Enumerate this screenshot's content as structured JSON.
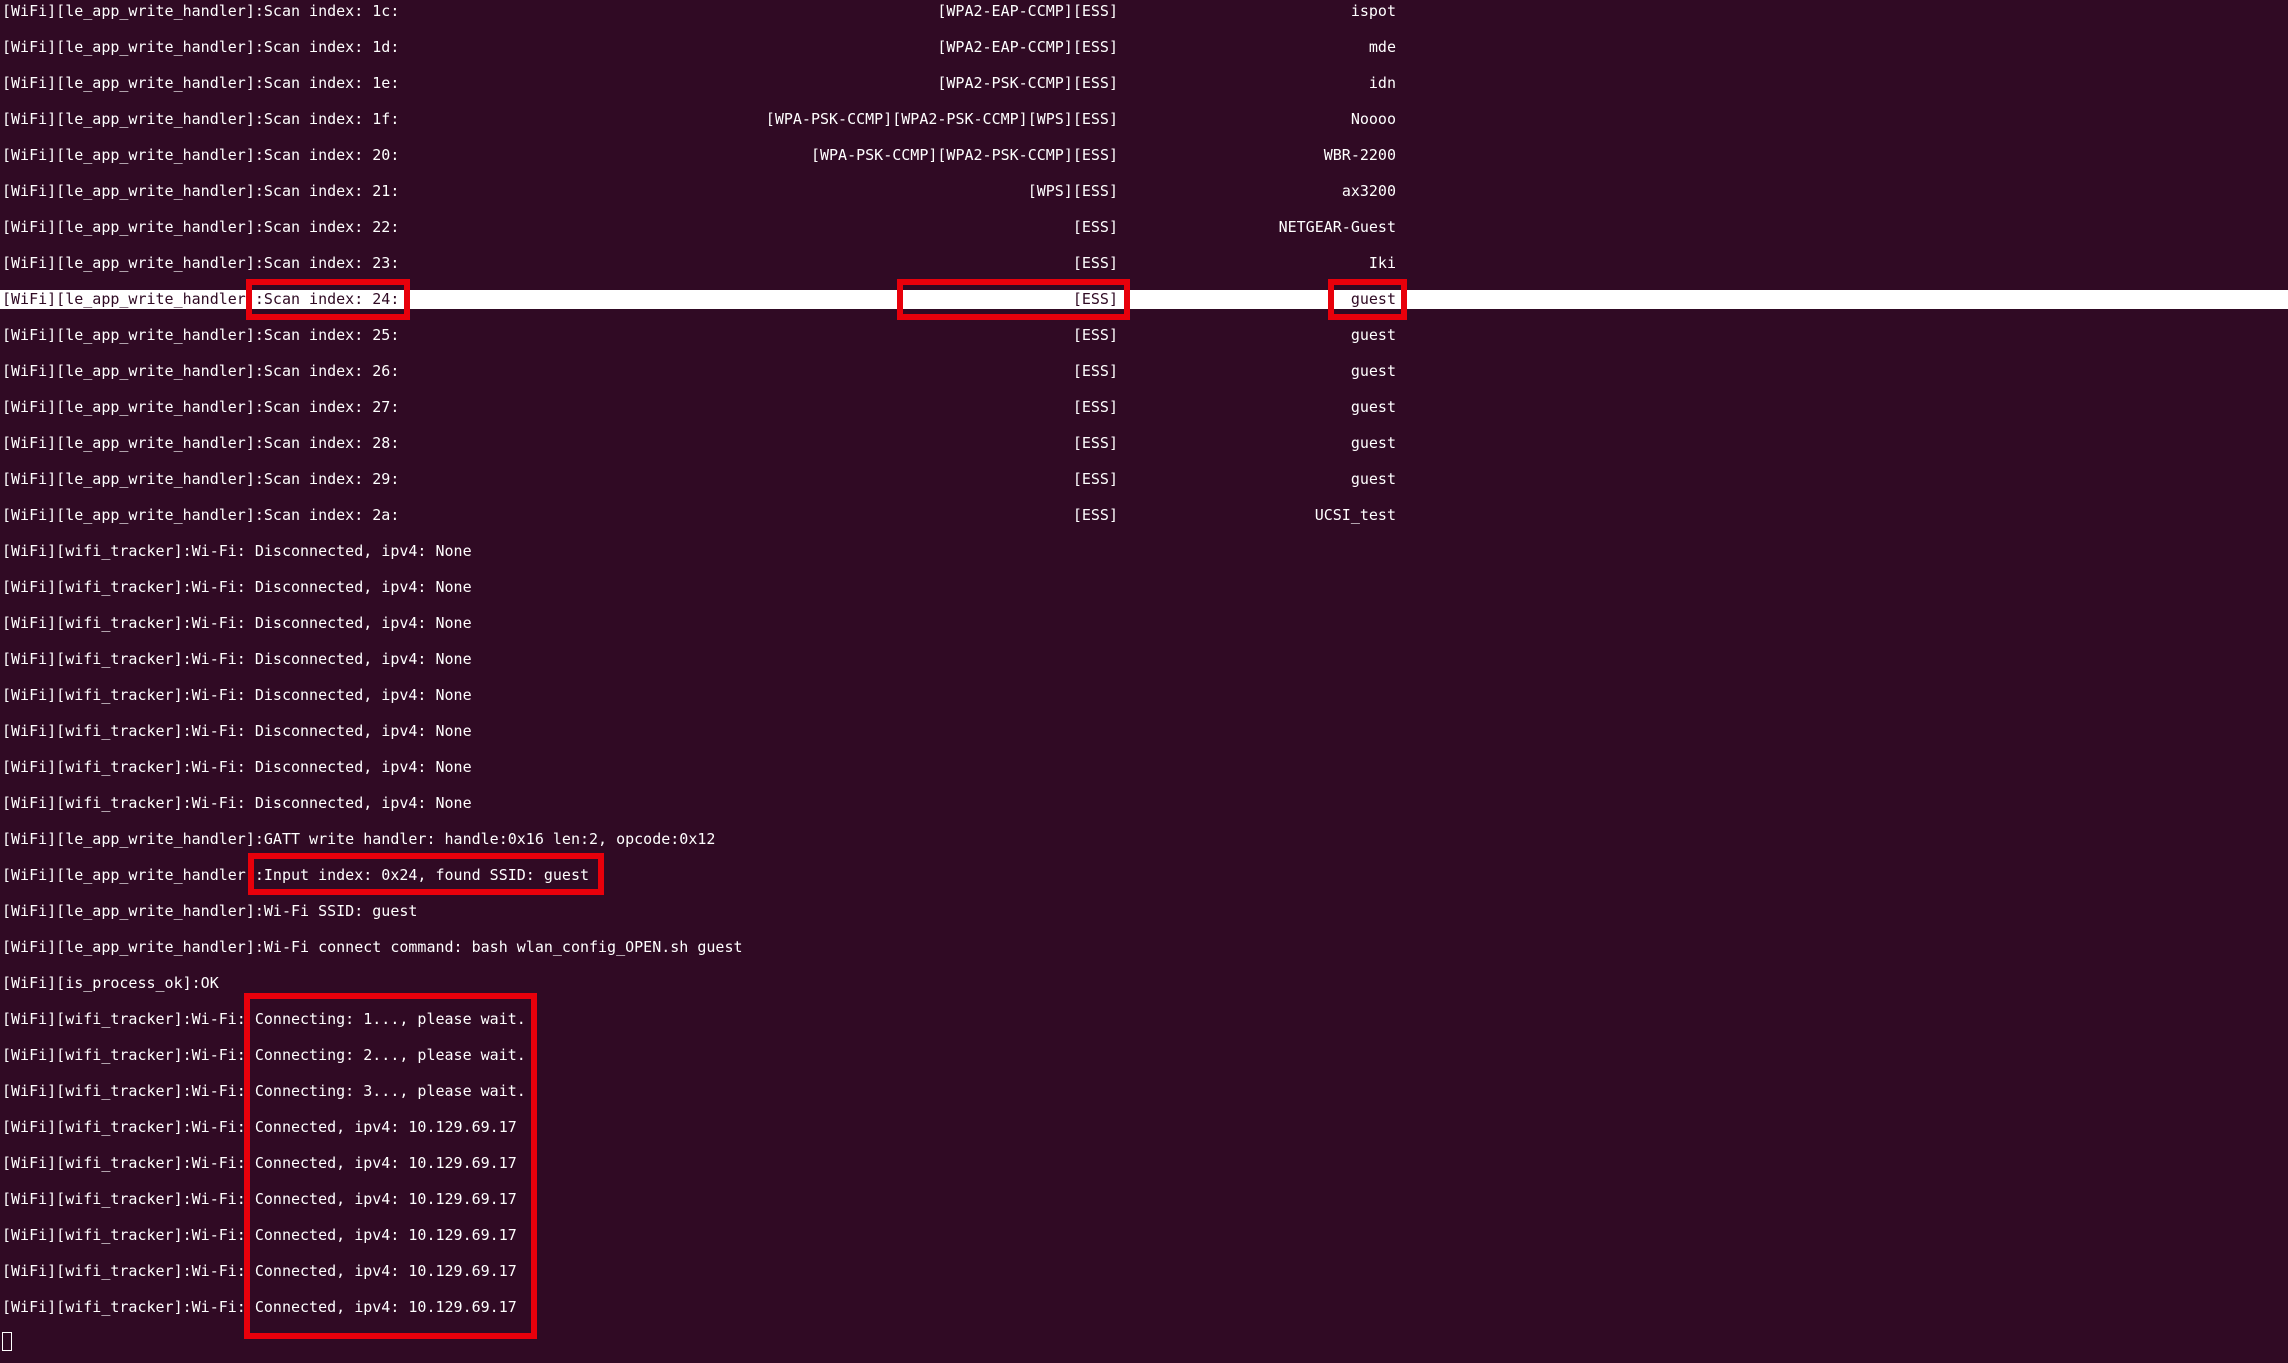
{
  "scan_rows": [
    {
      "prefix": "[WiFi][le_app_write_handler]:Scan index: 1c:",
      "flags": "[WPA2-EAP-CCMP][ESS]",
      "ssid": "ispot"
    },
    {
      "prefix": "[WiFi][le_app_write_handler]:Scan index: 1d:",
      "flags": "[WPA2-EAP-CCMP][ESS]",
      "ssid": "mde"
    },
    {
      "prefix": "[WiFi][le_app_write_handler]:Scan index: 1e:",
      "flags": "[WPA2-PSK-CCMP][ESS]",
      "ssid": "idn"
    },
    {
      "prefix": "[WiFi][le_app_write_handler]:Scan index: 1f:",
      "flags": "[WPA-PSK-CCMP][WPA2-PSK-CCMP][WPS][ESS]",
      "ssid": "Noooo"
    },
    {
      "prefix": "[WiFi][le_app_write_handler]:Scan index: 20:",
      "flags": "[WPA-PSK-CCMP][WPA2-PSK-CCMP][ESS]",
      "ssid": "WBR-2200"
    },
    {
      "prefix": "[WiFi][le_app_write_handler]:Scan index: 21:",
      "flags": "[WPS][ESS]",
      "ssid": "ax3200"
    },
    {
      "prefix": "[WiFi][le_app_write_handler]:Scan index: 22:",
      "flags": "[ESS]",
      "ssid": "NETGEAR-Guest"
    },
    {
      "prefix": "[WiFi][le_app_write_handler]:Scan index: 23:",
      "flags": "[ESS]",
      "ssid": "Iki"
    },
    {
      "prefix": "[WiFi][le_app_write_handler]:Scan index: 24:",
      "flags": "[ESS]",
      "ssid": "guest"
    },
    {
      "prefix": "[WiFi][le_app_write_handler]:Scan index: 25:",
      "flags": "[ESS]",
      "ssid": "guest"
    },
    {
      "prefix": "[WiFi][le_app_write_handler]:Scan index: 26:",
      "flags": "[ESS]",
      "ssid": "guest"
    },
    {
      "prefix": "[WiFi][le_app_write_handler]:Scan index: 27:",
      "flags": "[ESS]",
      "ssid": "guest"
    },
    {
      "prefix": "[WiFi][le_app_write_handler]:Scan index: 28:",
      "flags": "[ESS]",
      "ssid": "guest"
    },
    {
      "prefix": "[WiFi][le_app_write_handler]:Scan index: 29:",
      "flags": "[ESS]",
      "ssid": "guest"
    },
    {
      "prefix": "[WiFi][le_app_write_handler]:Scan index: 2a:",
      "flags": "[ESS]",
      "ssid": "UCSI_test"
    }
  ],
  "log_lines": [
    "[WiFi][wifi_tracker]:Wi-Fi: Disconnected, ipv4: None",
    "[WiFi][wifi_tracker]:Wi-Fi: Disconnected, ipv4: None",
    "[WiFi][wifi_tracker]:Wi-Fi: Disconnected, ipv4: None",
    "[WiFi][wifi_tracker]:Wi-Fi: Disconnected, ipv4: None",
    "[WiFi][wifi_tracker]:Wi-Fi: Disconnected, ipv4: None",
    "[WiFi][wifi_tracker]:Wi-Fi: Disconnected, ipv4: None",
    "[WiFi][wifi_tracker]:Wi-Fi: Disconnected, ipv4: None",
    "[WiFi][wifi_tracker]:Wi-Fi: Disconnected, ipv4: None",
    "[WiFi][le_app_write_handler]:GATT write handler: handle:0x16 len:2, opcode:0x12",
    "[WiFi][le_app_write_handler]:Input index: 0x24, found SSID: guest",
    "[WiFi][le_app_write_handler]:Wi-Fi SSID: guest",
    "[WiFi][le_app_write_handler]:Wi-Fi connect command: bash wlan_config_OPEN.sh guest",
    "[WiFi][is_process_ok]:OK",
    "[WiFi][wifi_tracker]:Wi-Fi: Connecting: 1..., please wait.",
    "[WiFi][wifi_tracker]:Wi-Fi: Connecting: 2..., please wait.",
    "[WiFi][wifi_tracker]:Wi-Fi: Connecting: 3..., please wait.",
    "[WiFi][wifi_tracker]:Wi-Fi: Connected, ipv4: 10.129.69.17",
    "[WiFi][wifi_tracker]:Wi-Fi: Connected, ipv4: 10.129.69.17",
    "[WiFi][wifi_tracker]:Wi-Fi: Connected, ipv4: 10.129.69.17",
    "[WiFi][wifi_tracker]:Wi-Fi: Connected, ipv4: 10.129.69.17",
    "[WiFi][wifi_tracker]:Wi-Fi: Connected, ipv4: 10.129.69.17",
    "[WiFi][wifi_tracker]:Wi-Fi: Connected, ipv4: 10.129.69.17"
  ],
  "highlighted_scan_row": 8,
  "colors": {
    "background": "#300a24",
    "text": "#ffffff",
    "annotation": "#e8000b",
    "highlight_bg": "#ffffff"
  }
}
